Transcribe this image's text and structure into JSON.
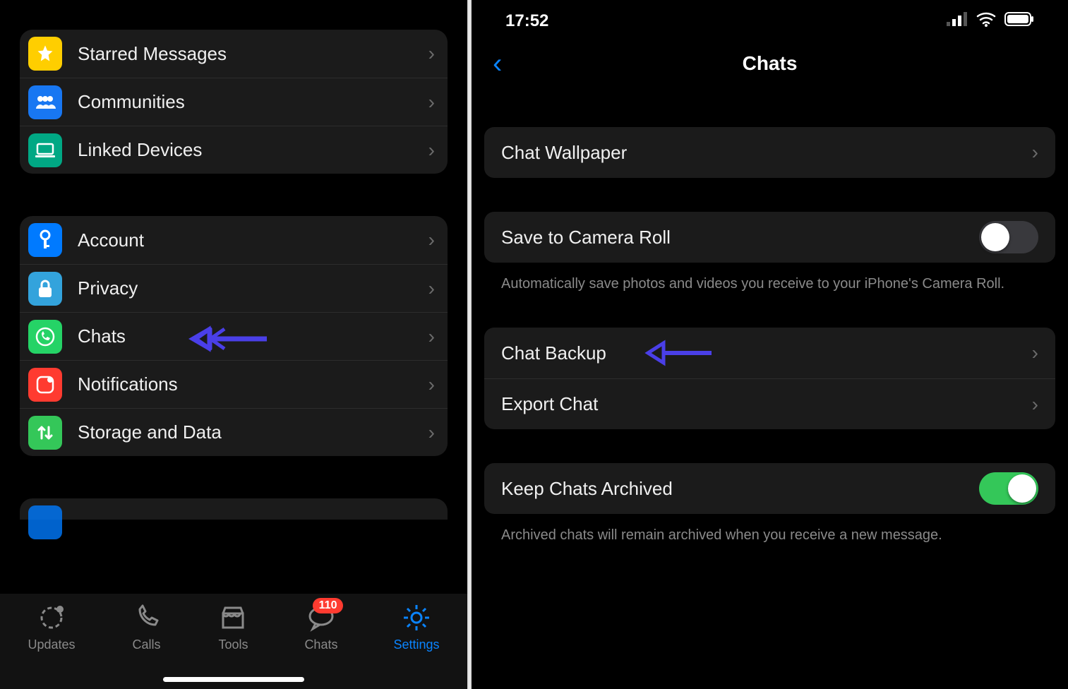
{
  "left": {
    "group1": [
      {
        "label": "Starred Messages",
        "icon": "star-icon",
        "bg": "ic-yellow"
      },
      {
        "label": "Communities",
        "icon": "people-icon",
        "bg": "ic-blue"
      },
      {
        "label": "Linked Devices",
        "icon": "laptop-icon",
        "bg": "ic-teal"
      }
    ],
    "group2": [
      {
        "label": "Account",
        "icon": "key-icon",
        "bg": "ic-blue2"
      },
      {
        "label": "Privacy",
        "icon": "lock-icon",
        "bg": "ic-lblue"
      },
      {
        "label": "Chats",
        "icon": "whatsapp-icon",
        "bg": "ic-green",
        "annotated": true
      },
      {
        "label": "Notifications",
        "icon": "notification-icon",
        "bg": "ic-red"
      },
      {
        "label": "Storage and Data",
        "icon": "arrows-updown-icon",
        "bg": "ic-green2"
      }
    ],
    "tabs": [
      {
        "label": "Updates",
        "icon": "updates-icon"
      },
      {
        "label": "Calls",
        "icon": "phone-icon"
      },
      {
        "label": "Tools",
        "icon": "storefront-icon"
      },
      {
        "label": "Chats",
        "icon": "chat-bubble-icon",
        "badge": "110"
      },
      {
        "label": "Settings",
        "icon": "gear-icon",
        "active": true
      }
    ]
  },
  "right": {
    "status_time": "17:52",
    "nav_title": "Chats",
    "rows": {
      "wallpaper": "Chat Wallpaper",
      "save_roll": "Save to Camera Roll",
      "save_roll_note": "Automatically save photos and videos you receive to your iPhone's Camera Roll.",
      "backup": "Chat Backup",
      "export": "Export Chat",
      "keep_archived": "Keep Chats Archived",
      "keep_archived_note": "Archived chats will remain archived when you receive a new message."
    },
    "toggles": {
      "save_roll": false,
      "keep_archived": true
    }
  },
  "annotation_color": "#4a3fe8"
}
